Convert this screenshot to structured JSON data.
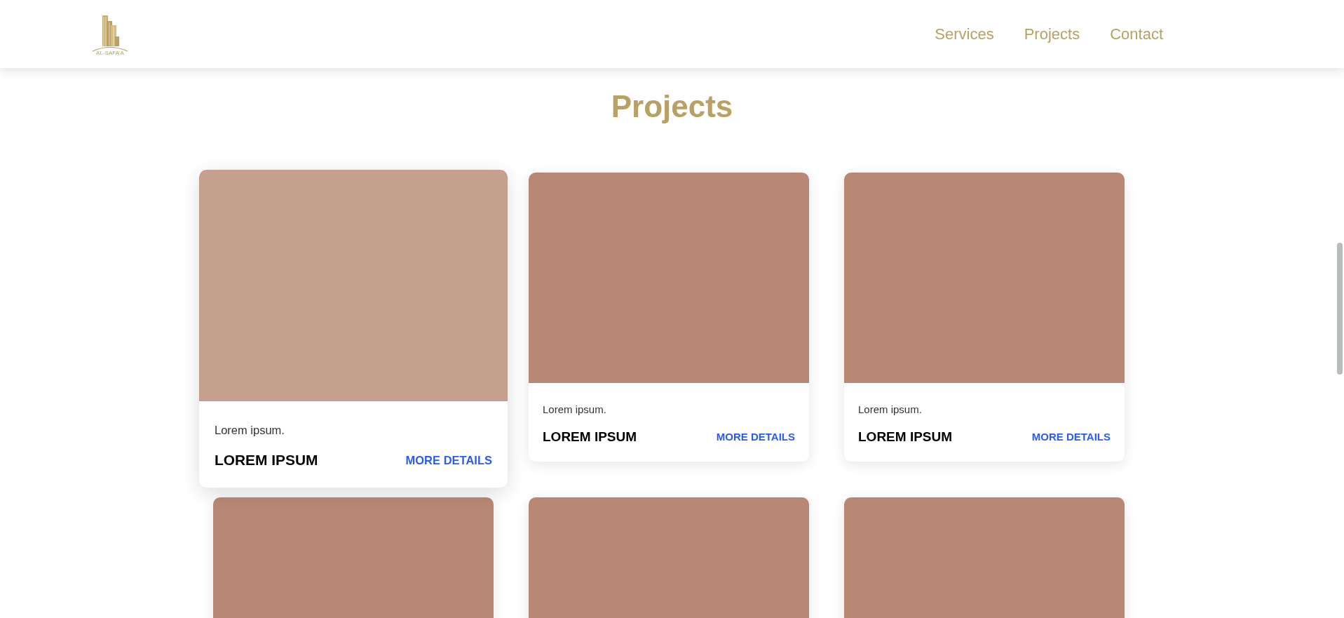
{
  "header": {
    "logo_text": "AL-SAFA'A",
    "nav": [
      {
        "label": "Services"
      },
      {
        "label": "Projects"
      },
      {
        "label": "Contact"
      }
    ]
  },
  "section_title": "Projects",
  "cards": [
    {
      "caption": "Lorem ipsum.",
      "title": "LOREM IPSUM",
      "link": "MORE DETAILS",
      "hovered": true
    },
    {
      "caption": "Lorem ipsum.",
      "title": "LOREM IPSUM",
      "link": "MORE DETAILS",
      "hovered": false
    },
    {
      "caption": "Lorem ipsum.",
      "title": "LOREM IPSUM",
      "link": "MORE DETAILS",
      "hovered": false
    },
    {
      "hovered": false
    },
    {
      "hovered": false
    },
    {
      "hovered": false
    }
  ]
}
